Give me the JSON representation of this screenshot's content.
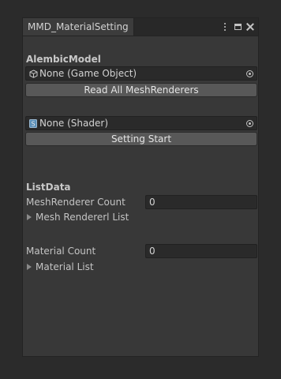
{
  "window": {
    "tab_title": "MMD_MaterialSetting",
    "controls": [
      "more-options-icon",
      "maximize-icon",
      "close-icon"
    ]
  },
  "alembic": {
    "header": "AlembicModel",
    "object_field": {
      "value": "None (Game Object)",
      "icon": "gameobject-cube-icon"
    },
    "button_label": "Read All MeshRenderers"
  },
  "shader": {
    "object_field": {
      "value": "None (Shader)",
      "icon": "shader-icon"
    },
    "button_label": "Setting Start"
  },
  "list_data": {
    "header": "ListData",
    "mesh_renderer_count": {
      "label": "MeshRenderer Count",
      "value": "0"
    },
    "mesh_renderer_list": {
      "label": "Mesh Rendererl List",
      "expanded": false
    },
    "material_count": {
      "label": "Material Count",
      "value": "0"
    },
    "material_list": {
      "label": "Material List",
      "expanded": false
    }
  },
  "colors": {
    "background": "#2b2b2b",
    "panel": "#383838",
    "field": "#2a2a2a",
    "button": "#585858",
    "text": "#c4c4c4"
  }
}
